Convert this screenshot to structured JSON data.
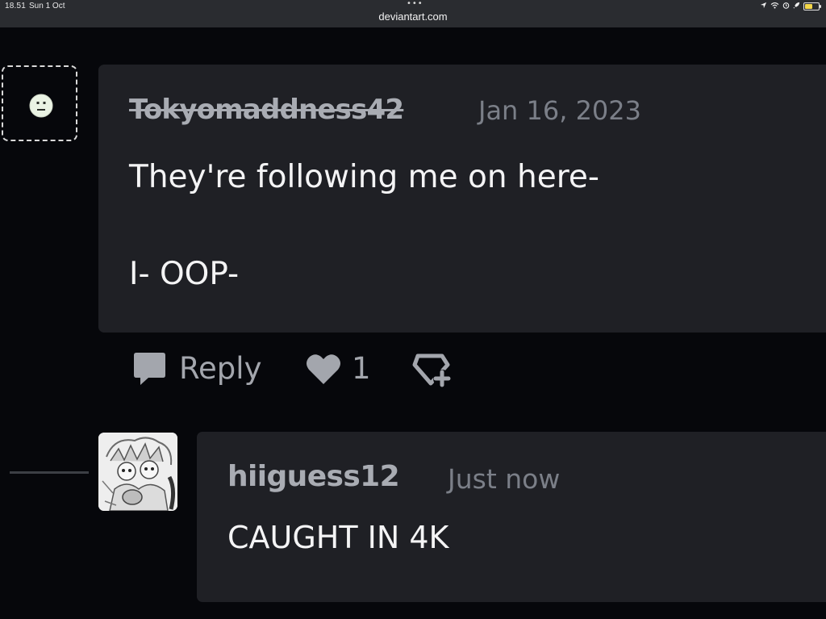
{
  "status_bar": {
    "time": "18.51",
    "date": "Sun 1 Oct",
    "url": "deviantart.com",
    "menu_dots": "•••",
    "icons": [
      "location-icon",
      "wifi-icon",
      "alarm-icon",
      "rocket-icon",
      "battery-icon"
    ]
  },
  "comment": {
    "username": "Tokyomaddness42",
    "date": "Jan 16, 2023",
    "body_line1": "They're following me on here-",
    "body_line2": "I- OOP-",
    "actions": {
      "reply_label": "Reply",
      "favourite_count": "1"
    }
  },
  "reply": {
    "username": "hiiguess12",
    "date": "Just now",
    "body": "CAUGHT IN 4K"
  },
  "colors": {
    "background": "#06070b",
    "card": "#1f2025",
    "text": "#f4f4f5",
    "muted": "#a3a6ad",
    "date": "#7b7f88"
  }
}
